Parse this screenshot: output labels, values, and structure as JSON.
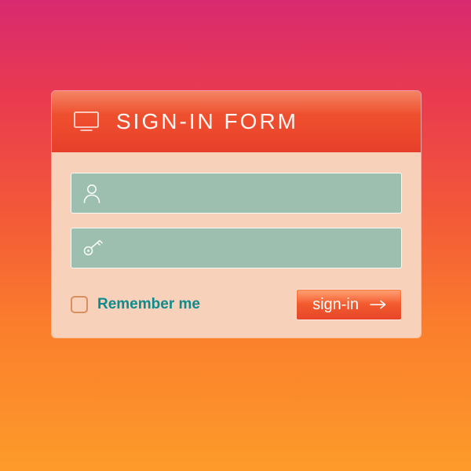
{
  "header": {
    "title": "SIGN-IN FORM"
  },
  "fields": {
    "username": {
      "value": "",
      "placeholder": ""
    },
    "password": {
      "value": "",
      "placeholder": ""
    }
  },
  "remember": {
    "label": "Remember me",
    "checked": false
  },
  "submit": {
    "label": "sign-in"
  },
  "colors": {
    "accent": "#f25a2e",
    "field_bg": "#9cbfb0",
    "body_bg": "#f7d1b9",
    "link": "#0d8b8f"
  }
}
